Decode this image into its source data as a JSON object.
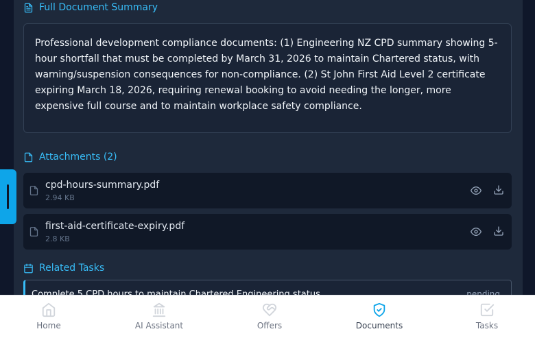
{
  "summary": {
    "title": "Full Document Summary",
    "text": "Professional development compliance documents: (1) Engineering NZ CPD summary showing 5-hour shortfall that must be completed by March 31, 2026 to maintain Chartered status, with warning/suspension consequences for non-compliance. (2) St John First Aid Level 2 certificate expiring March 18, 2026, requiring renewal booking to avoid needing the longer, more expensive full course and to maintain workplace safety compliance."
  },
  "attachments": {
    "title": "Attachments (2)",
    "items": [
      {
        "name": "cpd-hours-summary.pdf",
        "size": "2.94 KB"
      },
      {
        "name": "first-aid-certificate-expiry.pdf",
        "size": "2.8 KB"
      }
    ]
  },
  "related_tasks": {
    "title": "Related Tasks",
    "items": [
      {
        "title": "Complete 5 CPD hours to maintain Chartered Engineering status",
        "status": "pending"
      }
    ]
  },
  "bottom_nav": {
    "items": [
      {
        "label": "Home",
        "icon": "home-icon"
      },
      {
        "label": "AI Assistant",
        "icon": "bank-icon"
      },
      {
        "label": "Offers",
        "icon": "heart-handshake-icon"
      },
      {
        "label": "Documents",
        "icon": "shield-check-icon",
        "active": true
      },
      {
        "label": "Tasks",
        "icon": "check-square-icon"
      }
    ]
  },
  "colors": {
    "accent": "#38bdf8",
    "background": "#1e293b",
    "handle": "#0ea5e9"
  }
}
